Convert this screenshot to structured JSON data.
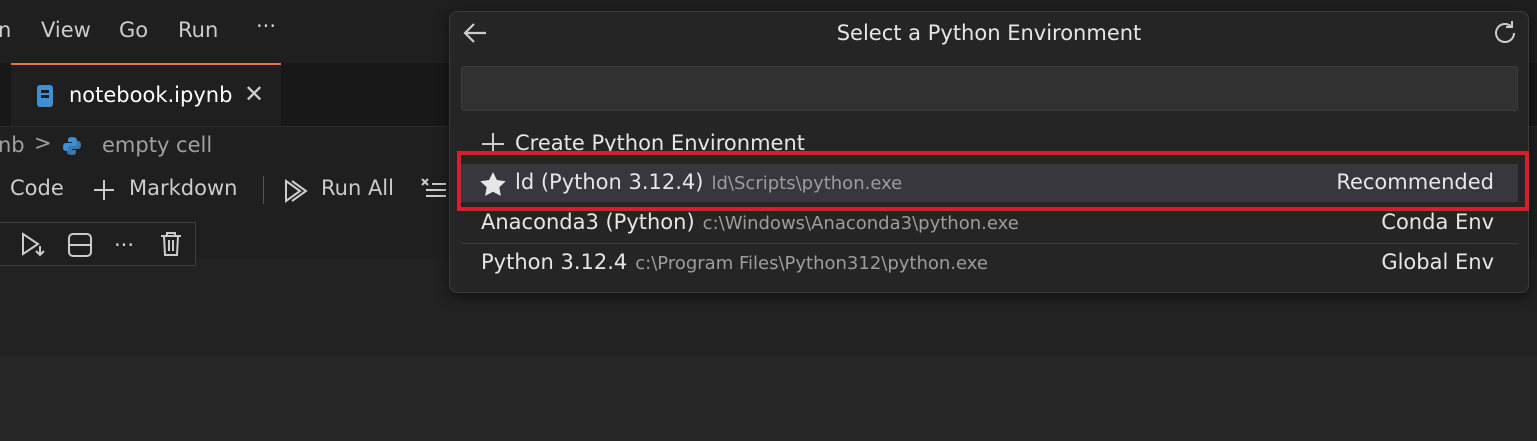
{
  "menubar": {
    "items": [
      "n",
      "View",
      "Go",
      "Run",
      "···"
    ]
  },
  "tab": {
    "label": "notebook.ipynb",
    "close": "✕"
  },
  "breadcrumb": {
    "prefix": "nb",
    "separator": ">",
    "cell": "empty cell"
  },
  "toolbar": {
    "code_label": "Code",
    "markdown_label": "Markdown",
    "run_all_label": "Run All"
  },
  "quickpick": {
    "title": "Select a Python Environment",
    "input_value": "",
    "create_label": "Create Python Environment",
    "items": [
      {
        "label": "ld (Python 3.12.4)",
        "path": "ld\\Scripts\\python.exe",
        "tag": "Recommended"
      },
      {
        "label": "Anaconda3 (Python)",
        "path": "c:\\Windows\\Anaconda3\\python.exe",
        "tag": "Conda Env"
      },
      {
        "label": "Python 3.12.4",
        "path": "c:\\Program Files\\Python312\\python.exe",
        "tag": "Global Env"
      }
    ]
  },
  "colors": {
    "tab_accent": "#e8743b",
    "highlight": "#d4202c",
    "notebook_icon": "#3f8fd2"
  }
}
